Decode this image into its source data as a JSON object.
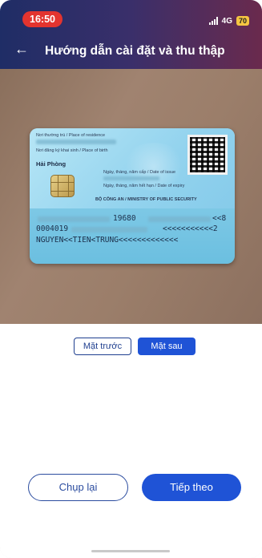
{
  "status_bar": {
    "time": "16:50",
    "network": "4G",
    "battery": "70",
    "colors": {
      "time_pill": "#e3342f",
      "battery": "#f5c542"
    }
  },
  "header": {
    "back_icon": "arrow-left-icon",
    "title": "Hướng dẫn cài đặt và thu thập"
  },
  "id_card": {
    "labels": {
      "place_of_residence": "Nơi thường trú / Place of residence",
      "place_of_birth": "Nơi đăng ký khai sinh / Place of birth",
      "date_of_issue": "Ngày, tháng, năm cấp / Date of issue",
      "date_of_expiry": "Ngày, tháng, năm hết hạn / Date of expiry",
      "issuer": "BỘ CÔNG AN / MINISTRY OF PUBLIC SECURITY"
    },
    "place_of_birth_value": "Hải Phòng",
    "mrz_line1_visible": "19680",
    "mrz_line1_end": "<<8",
    "mrz_line2_start": "0004019",
    "mrz_line2_end": "<<<<<<<<<<<2",
    "mrz_line3": "NGUYEN<<TIEN<TRUNG<<<<<<<<<<<<<"
  },
  "side_toggle": {
    "front_label": "Mặt trước",
    "back_label": "Mặt sau",
    "selected": "back"
  },
  "actions": {
    "retake_label": "Chụp lại",
    "next_label": "Tiếp theo"
  },
  "colors": {
    "primary": "#1f53d6",
    "outline": "#2b4c9f",
    "header_gradient_start": "#1f2d66",
    "header_gradient_end": "#6a2a4d"
  }
}
